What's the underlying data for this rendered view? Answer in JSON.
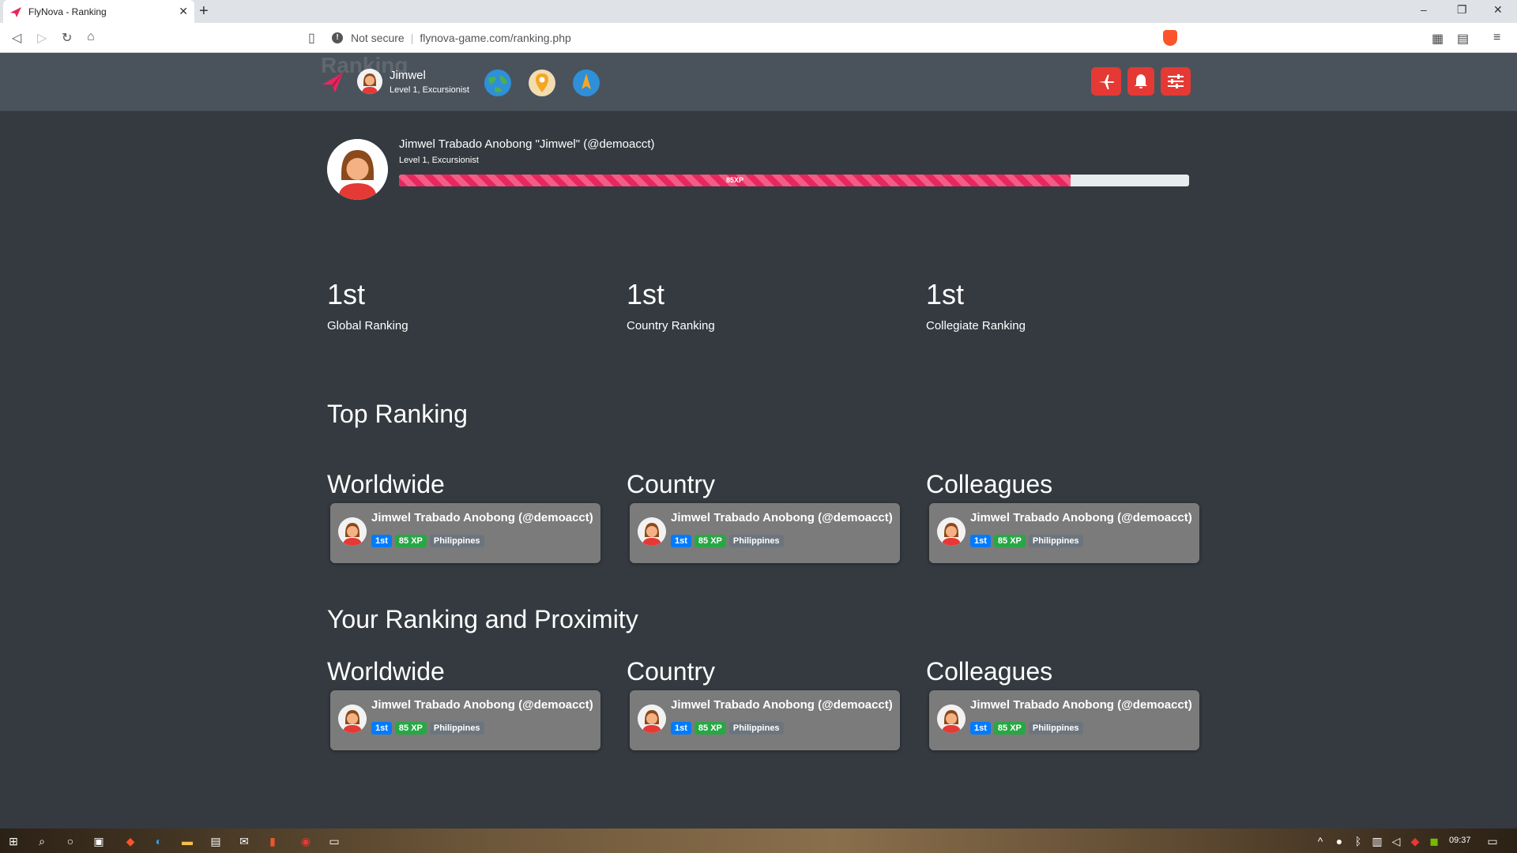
{
  "browser": {
    "tab_title": "FlyNova - Ranking",
    "tab_close": "✕",
    "new_tab": "+",
    "security_label": "Not secure",
    "url": "flynova-game.com/ranking.php",
    "win_minimize": "–",
    "win_restore": "❐",
    "win_close": "✕"
  },
  "header": {
    "ghost_title": "Ranking",
    "user_name": "Jimwel",
    "user_level": "Level 1, Excursionist",
    "icons": [
      "earth-icon",
      "map-pin-icon",
      "compass-icon"
    ],
    "buttons": [
      "plane-icon",
      "bell-icon",
      "settings-sliders-icon"
    ]
  },
  "profile": {
    "full_name": "Jimwel Trabado Anobong \"Jimwel\" (@demoacct)",
    "level": "Level 1, Excursionist",
    "xp_label": "85XP",
    "xp_progress": 0.85
  },
  "stats": [
    {
      "rank": "1st",
      "label": "Global Ranking"
    },
    {
      "rank": "1st",
      "label": "Country Ranking"
    },
    {
      "rank": "1st",
      "label": "Collegiate Ranking"
    }
  ],
  "top_ranking": {
    "title": "Top Ranking",
    "columns": [
      {
        "title": "Worldwide",
        "name": "Jimwel Trabado Anobong (@demoacct)",
        "rank": "1st",
        "xp": "85 XP",
        "country": "Philippines"
      },
      {
        "title": "Country",
        "name": "Jimwel Trabado Anobong (@demoacct)",
        "rank": "1st",
        "xp": "85 XP",
        "country": "Philippines"
      },
      {
        "title": "Colleagues",
        "name": "Jimwel Trabado Anobong (@demoacct)",
        "rank": "1st",
        "xp": "85 XP",
        "country": "Philippines"
      }
    ]
  },
  "proximity": {
    "title": "Your Ranking and Proximity",
    "columns": [
      {
        "title": "Worldwide",
        "name": "Jimwel Trabado Anobong (@demoacct)",
        "rank": "1st",
        "xp": "85 XP",
        "country": "Philippines"
      },
      {
        "title": "Country",
        "name": "Jimwel Trabado Anobong (@demoacct)",
        "rank": "1st",
        "xp": "85 XP",
        "country": "Philippines"
      },
      {
        "title": "Colleagues",
        "name": "Jimwel Trabado Anobong (@demoacct)",
        "rank": "1st",
        "xp": "85 XP",
        "country": "Philippines"
      }
    ]
  },
  "taskbar": {
    "clock": "09:37"
  },
  "colors": {
    "page_bg": "#343a40",
    "header_bg": "#4a535c",
    "accent_red": "#e53935",
    "xp_pink": "#e8275e",
    "badge_blue": "#007bff",
    "badge_green": "#28a745"
  }
}
